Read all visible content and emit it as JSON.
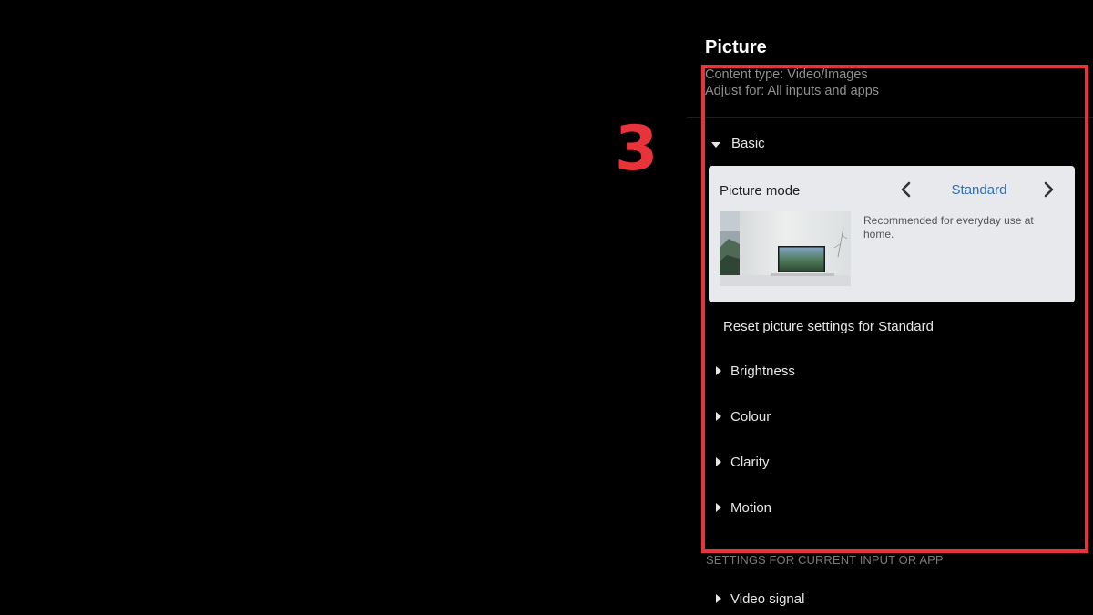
{
  "annotation": {
    "number": "3",
    "color": "#e8333a"
  },
  "panel": {
    "title": "Picture",
    "content_type": "Content type: Video/Images",
    "adjust_for": "Adjust for: All inputs and apps"
  },
  "basic": {
    "label": "Basic",
    "picture_mode": {
      "label": "Picture mode",
      "value": "Standard",
      "description": "Recommended for everyday use at home."
    },
    "reset_label": "Reset picture settings for Standard",
    "items": [
      {
        "label": "Brightness"
      },
      {
        "label": "Colour"
      },
      {
        "label": "Clarity"
      },
      {
        "label": "Motion"
      }
    ]
  },
  "current_input": {
    "header": "SETTINGS FOR CURRENT INPUT OR APP",
    "items": [
      {
        "label": "Video signal"
      }
    ]
  },
  "colors": {
    "accent": "#2f6fb6",
    "highlight": "#e8333a",
    "card_bg": "#e7e9ec"
  }
}
